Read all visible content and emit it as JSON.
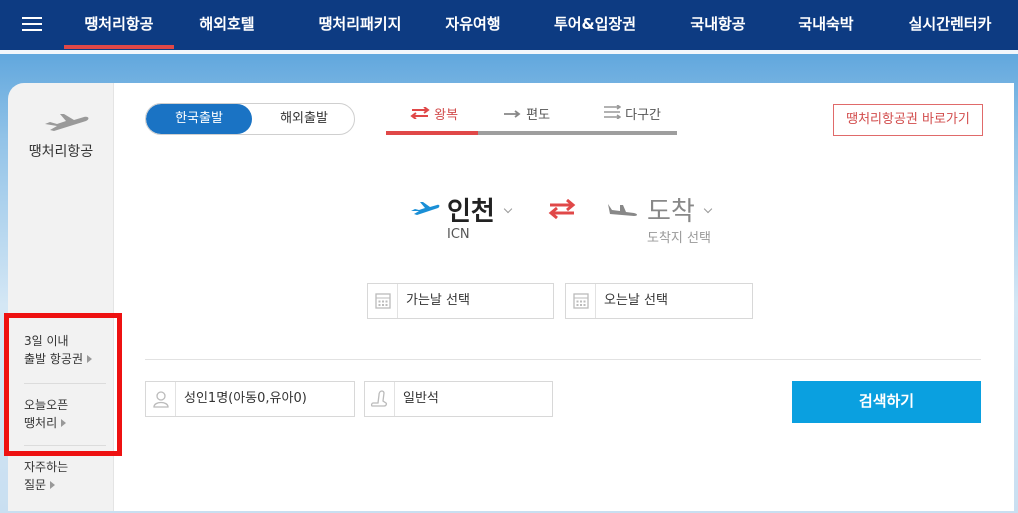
{
  "nav": {
    "items": [
      {
        "label": "땡처리항공"
      },
      {
        "label": "해외호텔"
      },
      {
        "label": "땡처리패키지"
      },
      {
        "label": "자유여행"
      },
      {
        "label": "투어&입장권"
      },
      {
        "label": "국내항공"
      },
      {
        "label": "국내숙박"
      },
      {
        "label": "실시간렌터카"
      }
    ],
    "active_index": 0
  },
  "sidebar": {
    "title": "땡처리항공",
    "links": [
      {
        "line1": "3일 이내",
        "line2": "출발 항공권"
      },
      {
        "line1": "오늘오픈",
        "line2": "땡처리"
      },
      {
        "line1": "자주하는",
        "line2": "질문"
      }
    ]
  },
  "search": {
    "departure_tabs": [
      {
        "label": "한국출발",
        "selected": true
      },
      {
        "label": "해외출발",
        "selected": false
      }
    ],
    "trip_types": [
      {
        "label": "왕복",
        "selected": true,
        "icon": "round-trip-icon"
      },
      {
        "label": "편도",
        "selected": false,
        "icon": "one-way-icon"
      },
      {
        "label": "다구간",
        "selected": false,
        "icon": "multi-city-icon"
      }
    ],
    "shortcut_label": "땡처리항공권 바로가기",
    "origin": {
      "city": "인천",
      "code": "ICN"
    },
    "destination": {
      "city": "도착",
      "placeholder": "도착지 선택"
    },
    "depart_date_label": "가는날 선택",
    "return_date_label": "오는날 선택",
    "passengers_label": "성인1명(아동0,유아0)",
    "cabin_label": "일반석",
    "search_button": "검색하기"
  },
  "colors": {
    "nav_bg": "#0d3b82",
    "accent_red": "#e04848",
    "primary_blue": "#1a73c4",
    "search_blue": "#0aa0e0",
    "highlight_box": "#ee1111"
  }
}
